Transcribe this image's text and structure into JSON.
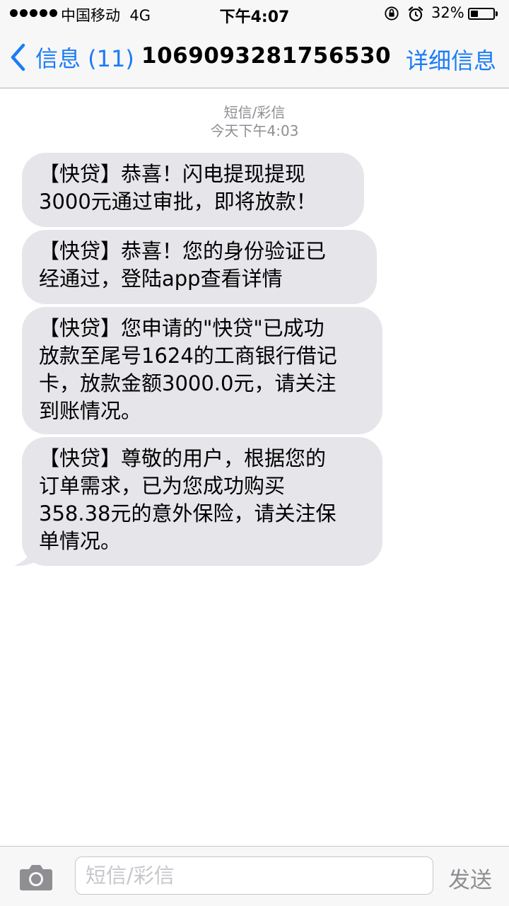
{
  "status_bar": {
    "carrier": "中国移动  4G",
    "time": "下午4:07",
    "battery_percent_label": "32%",
    "battery_level": 0.32
  },
  "nav": {
    "back_label": "信息 (11)",
    "title": "1069093281756530",
    "details_label": "详细信息",
    "accent_color": "#1a7cf6"
  },
  "conversation": {
    "message_type": "短信/彩信",
    "timestamp": "今天下午4:03",
    "messages": [
      "【快贷】恭喜！闪电提现提现\n3000元通过审批，即将放款！",
      "【快贷】恭喜！您的身份验证已\n经通过，登陆app查看详情",
      "【快贷】您申请的\"快贷\"已成功\n放款至尾号1624的工商银行借记\n卡，放款金额3000.0元，请关注\n到账情况。",
      "【快贷】尊敬的用户，根据您的\n订单需求，已为您成功购买\n358.38元的意外保险，请关注保\n单情况。"
    ]
  },
  "input_bar": {
    "placeholder": "短信/彩信",
    "send_label": "发送"
  },
  "icons": {
    "signal": "signal-dots-icon",
    "rotation_lock": "rotation-lock-icon",
    "alarm": "alarm-icon",
    "battery": "battery-icon",
    "back": "chevron-left-icon",
    "camera": "camera-icon"
  }
}
